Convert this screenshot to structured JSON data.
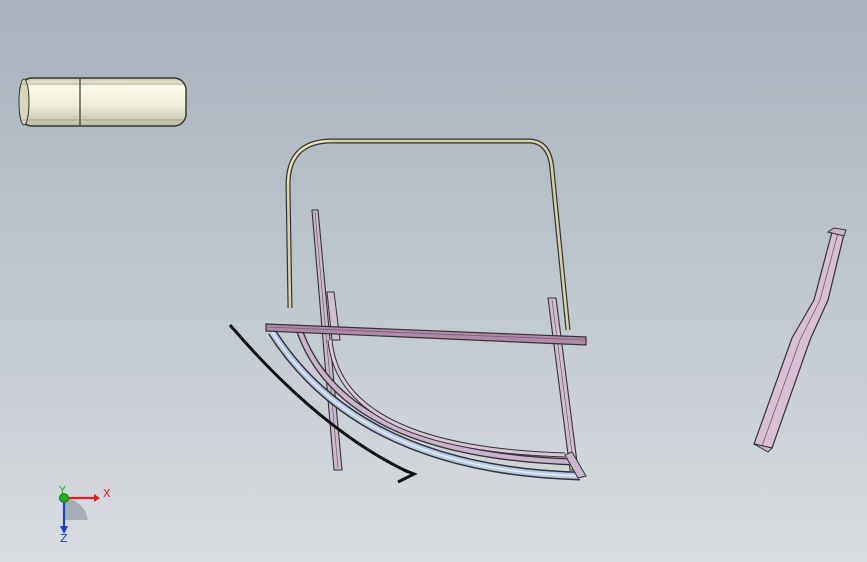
{
  "viewport": {
    "background_top": "#a9b2bd",
    "background_bottom": "#d9dde1"
  },
  "triad": {
    "x_label": "X",
    "y_label": "Y",
    "z_label": "Z",
    "x_color": "#e02020",
    "y_color": "#20b020",
    "z_color": "#2040d0"
  },
  "parts": [
    {
      "name": "cylindrical-spacer-part",
      "color": "#f3f1dc"
    },
    {
      "name": "door-window-frame-part",
      "color": "#d8d0a8"
    },
    {
      "name": "curved-lower-rail-part",
      "color": "#b7c9e8"
    },
    {
      "name": "horizontal-belt-rail-part",
      "color": "#b08aa8"
    },
    {
      "name": "side-channel-bracket-part",
      "color": "#d9bfd6"
    }
  ]
}
